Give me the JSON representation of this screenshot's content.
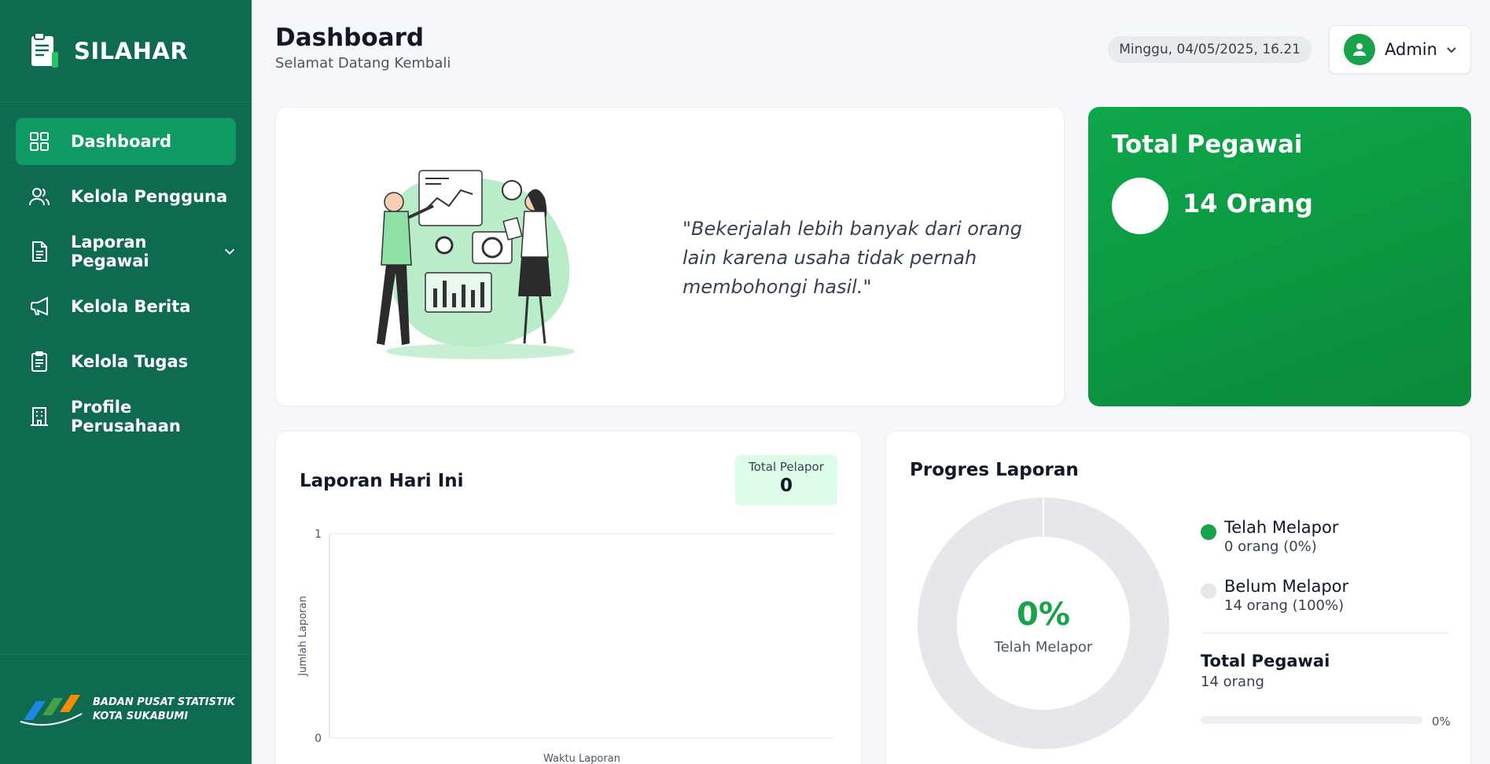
{
  "app": {
    "name": "SILAHAR"
  },
  "sidebar": {
    "items": [
      {
        "label": "Dashboard",
        "icon": "grid-icon",
        "active": true
      },
      {
        "label": "Kelola Pengguna",
        "icon": "users-icon"
      },
      {
        "label": "Laporan Pegawai",
        "icon": "document-icon",
        "has_submenu": true
      },
      {
        "label": "Kelola Berita",
        "icon": "megaphone-icon"
      },
      {
        "label": "Kelola Tugas",
        "icon": "clipboard-icon"
      },
      {
        "label": "Profile Perusahaan",
        "icon": "building-icon"
      }
    ],
    "footer": {
      "line1": "BADAN PUSAT STATISTIK",
      "line2": "KOTA SUKABUMI"
    }
  },
  "header": {
    "title": "Dashboard",
    "subtitle": "Selamat Datang Kembali",
    "datetime": "Minggu, 04/05/2025, 16.21",
    "user": "Admin"
  },
  "hero": {
    "quote": "\"Bekerjalah lebih banyak dari orang lain karena usaha tidak pernah membohongi hasil.\""
  },
  "total_pegawai": {
    "title": "Total Pegawai",
    "value": "14 Orang"
  },
  "laporan_hari_ini": {
    "title": "Laporan Hari Ini",
    "total_pelapor_label": "Total Pelapor",
    "total_pelapor_value": "0"
  },
  "progres": {
    "title": "Progres Laporan",
    "center_pct": "0%",
    "center_label": "Telah Melapor",
    "legend": [
      {
        "name": "Telah Melapor",
        "detail": "0 orang (0%)",
        "color": "#16a34a"
      },
      {
        "name": "Belum Melapor",
        "detail": "14 orang (100%)",
        "color": "#e5e7eb"
      }
    ],
    "total_label": "Total Pegawai",
    "total_value": "14 orang",
    "progress_fraction": 0,
    "progress_text": "0%"
  },
  "colors": {
    "sidebar": "#0e6b4f",
    "active": "#0f9a63",
    "accent": "#16a34a"
  },
  "chart_data": {
    "type": "line",
    "xlabel": "Waktu Laporan",
    "ylabel": "Jumlah Laporan",
    "ylim": [
      0,
      1
    ],
    "yticks": [
      "0",
      "1"
    ],
    "series": []
  }
}
